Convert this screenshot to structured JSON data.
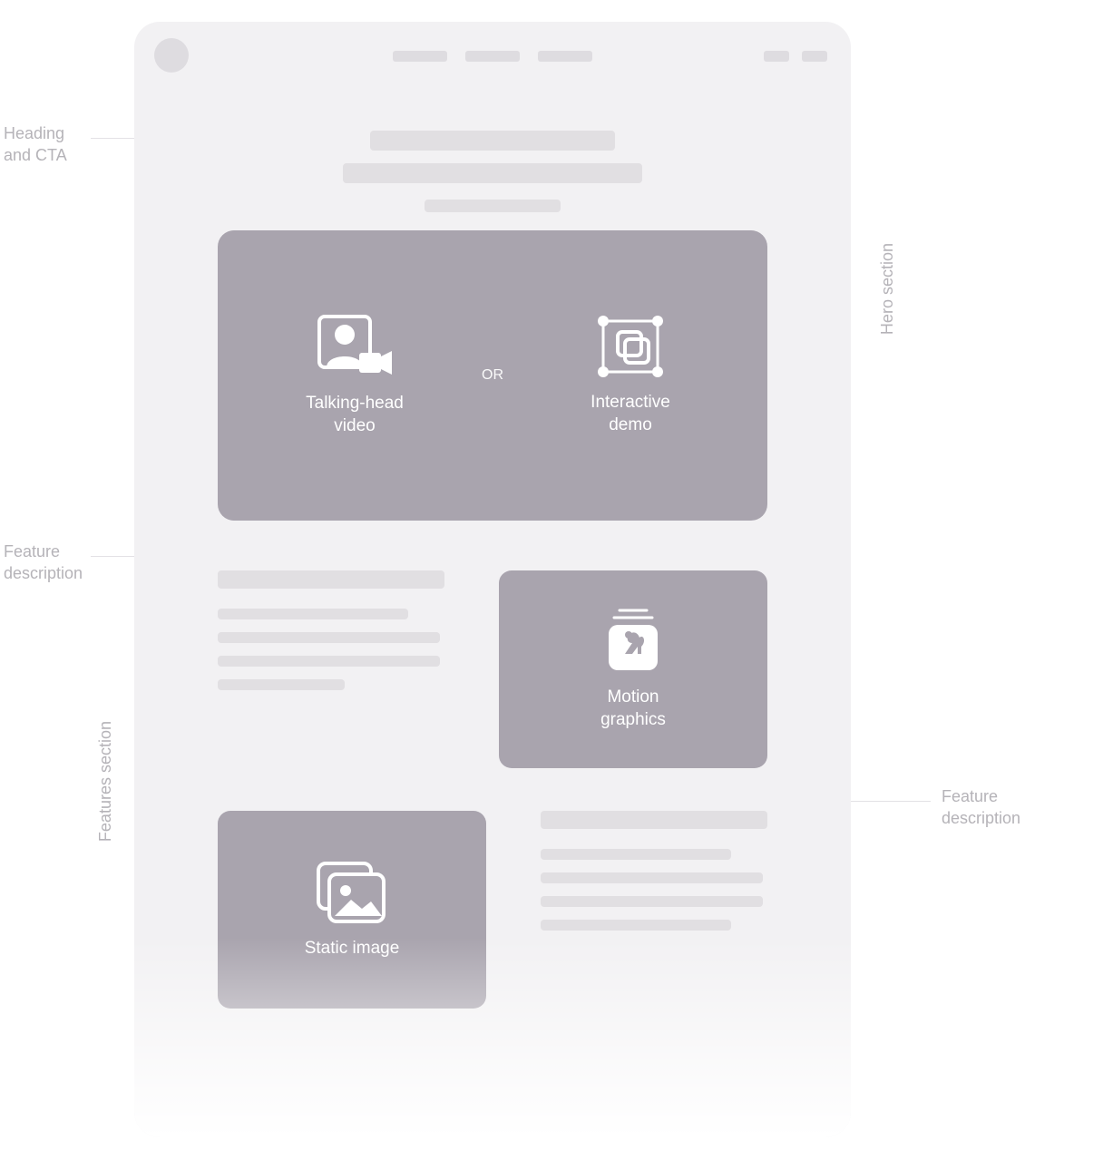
{
  "annotations": {
    "heading_cta": "Heading\nand CTA",
    "feature_desc_left": "Feature\ndescription",
    "feature_desc_right": "Feature\ndescription",
    "hero_section": "Hero section",
    "features_section": "Features section"
  },
  "hero": {
    "option_a": "Talking-head\nvideo",
    "separator": "OR",
    "option_b": "Interactive\ndemo"
  },
  "features": {
    "motion_graphics": "Motion\ngraphics",
    "static_image": "Static image"
  }
}
